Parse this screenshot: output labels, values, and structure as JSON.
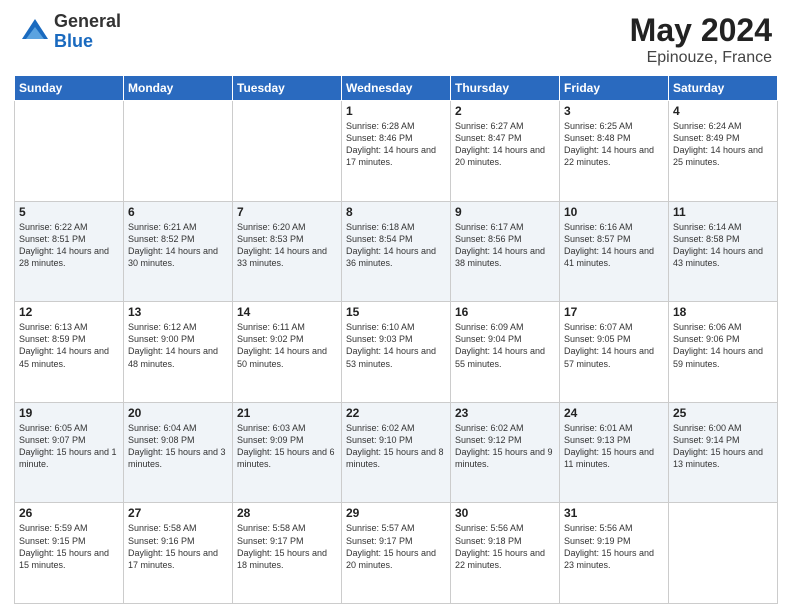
{
  "logo": {
    "general": "General",
    "blue": "Blue"
  },
  "header": {
    "month": "May 2024",
    "location": "Epinouze, France"
  },
  "days_of_week": [
    "Sunday",
    "Monday",
    "Tuesday",
    "Wednesday",
    "Thursday",
    "Friday",
    "Saturday"
  ],
  "weeks": [
    [
      {
        "day": "",
        "info": ""
      },
      {
        "day": "",
        "info": ""
      },
      {
        "day": "",
        "info": ""
      },
      {
        "day": "1",
        "info": "Sunrise: 6:28 AM\nSunset: 8:46 PM\nDaylight: 14 hours and 17 minutes."
      },
      {
        "day": "2",
        "info": "Sunrise: 6:27 AM\nSunset: 8:47 PM\nDaylight: 14 hours and 20 minutes."
      },
      {
        "day": "3",
        "info": "Sunrise: 6:25 AM\nSunset: 8:48 PM\nDaylight: 14 hours and 22 minutes."
      },
      {
        "day": "4",
        "info": "Sunrise: 6:24 AM\nSunset: 8:49 PM\nDaylight: 14 hours and 25 minutes."
      }
    ],
    [
      {
        "day": "5",
        "info": "Sunrise: 6:22 AM\nSunset: 8:51 PM\nDaylight: 14 hours and 28 minutes."
      },
      {
        "day": "6",
        "info": "Sunrise: 6:21 AM\nSunset: 8:52 PM\nDaylight: 14 hours and 30 minutes."
      },
      {
        "day": "7",
        "info": "Sunrise: 6:20 AM\nSunset: 8:53 PM\nDaylight: 14 hours and 33 minutes."
      },
      {
        "day": "8",
        "info": "Sunrise: 6:18 AM\nSunset: 8:54 PM\nDaylight: 14 hours and 36 minutes."
      },
      {
        "day": "9",
        "info": "Sunrise: 6:17 AM\nSunset: 8:56 PM\nDaylight: 14 hours and 38 minutes."
      },
      {
        "day": "10",
        "info": "Sunrise: 6:16 AM\nSunset: 8:57 PM\nDaylight: 14 hours and 41 minutes."
      },
      {
        "day": "11",
        "info": "Sunrise: 6:14 AM\nSunset: 8:58 PM\nDaylight: 14 hours and 43 minutes."
      }
    ],
    [
      {
        "day": "12",
        "info": "Sunrise: 6:13 AM\nSunset: 8:59 PM\nDaylight: 14 hours and 45 minutes."
      },
      {
        "day": "13",
        "info": "Sunrise: 6:12 AM\nSunset: 9:00 PM\nDaylight: 14 hours and 48 minutes."
      },
      {
        "day": "14",
        "info": "Sunrise: 6:11 AM\nSunset: 9:02 PM\nDaylight: 14 hours and 50 minutes."
      },
      {
        "day": "15",
        "info": "Sunrise: 6:10 AM\nSunset: 9:03 PM\nDaylight: 14 hours and 53 minutes."
      },
      {
        "day": "16",
        "info": "Sunrise: 6:09 AM\nSunset: 9:04 PM\nDaylight: 14 hours and 55 minutes."
      },
      {
        "day": "17",
        "info": "Sunrise: 6:07 AM\nSunset: 9:05 PM\nDaylight: 14 hours and 57 minutes."
      },
      {
        "day": "18",
        "info": "Sunrise: 6:06 AM\nSunset: 9:06 PM\nDaylight: 14 hours and 59 minutes."
      }
    ],
    [
      {
        "day": "19",
        "info": "Sunrise: 6:05 AM\nSunset: 9:07 PM\nDaylight: 15 hours and 1 minute."
      },
      {
        "day": "20",
        "info": "Sunrise: 6:04 AM\nSunset: 9:08 PM\nDaylight: 15 hours and 3 minutes."
      },
      {
        "day": "21",
        "info": "Sunrise: 6:03 AM\nSunset: 9:09 PM\nDaylight: 15 hours and 6 minutes."
      },
      {
        "day": "22",
        "info": "Sunrise: 6:02 AM\nSunset: 9:10 PM\nDaylight: 15 hours and 8 minutes."
      },
      {
        "day": "23",
        "info": "Sunrise: 6:02 AM\nSunset: 9:12 PM\nDaylight: 15 hours and 9 minutes."
      },
      {
        "day": "24",
        "info": "Sunrise: 6:01 AM\nSunset: 9:13 PM\nDaylight: 15 hours and 11 minutes."
      },
      {
        "day": "25",
        "info": "Sunrise: 6:00 AM\nSunset: 9:14 PM\nDaylight: 15 hours and 13 minutes."
      }
    ],
    [
      {
        "day": "26",
        "info": "Sunrise: 5:59 AM\nSunset: 9:15 PM\nDaylight: 15 hours and 15 minutes."
      },
      {
        "day": "27",
        "info": "Sunrise: 5:58 AM\nSunset: 9:16 PM\nDaylight: 15 hours and 17 minutes."
      },
      {
        "day": "28",
        "info": "Sunrise: 5:58 AM\nSunset: 9:17 PM\nDaylight: 15 hours and 18 minutes."
      },
      {
        "day": "29",
        "info": "Sunrise: 5:57 AM\nSunset: 9:17 PM\nDaylight: 15 hours and 20 minutes."
      },
      {
        "day": "30",
        "info": "Sunrise: 5:56 AM\nSunset: 9:18 PM\nDaylight: 15 hours and 22 minutes."
      },
      {
        "day": "31",
        "info": "Sunrise: 5:56 AM\nSunset: 9:19 PM\nDaylight: 15 hours and 23 minutes."
      },
      {
        "day": "",
        "info": ""
      }
    ]
  ]
}
